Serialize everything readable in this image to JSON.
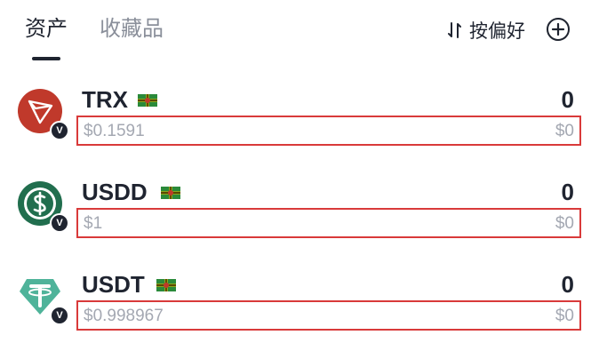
{
  "tabs": [
    {
      "label": "资产",
      "active": true
    },
    {
      "label": "收藏品",
      "active": false
    }
  ],
  "toolbar": {
    "sort_label": "按偏好",
    "sort_icon": "sort-arrows-icon",
    "add_icon": "plus-circle-icon"
  },
  "assets": [
    {
      "symbol": "TRX",
      "balance": "0",
      "price": "$0.1591",
      "fiat_value": "$0",
      "logo_color": "#c0392b",
      "badge": "V"
    },
    {
      "symbol": "USDD",
      "balance": "0",
      "price": "$1",
      "fiat_value": "$0",
      "logo_color": "#216e4e",
      "badge": "V"
    },
    {
      "symbol": "USDT",
      "balance": "0",
      "price": "$0.998967",
      "fiat_value": "$0",
      "logo_color": "#4fb39a",
      "badge": "V"
    }
  ],
  "colors": {
    "highlight": "#d93a3a",
    "muted_text": "#a4a8b2",
    "primary_text": "#1f2430"
  }
}
